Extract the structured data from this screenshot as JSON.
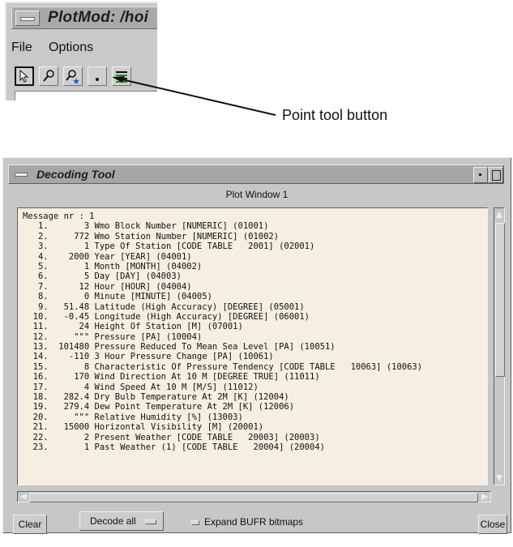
{
  "plotmod": {
    "title": "PlotMod: /hoi",
    "menu": [
      "File",
      "Options"
    ]
  },
  "callout": {
    "label": "Point tool button"
  },
  "decoding_tool": {
    "title": "Decoding Tool",
    "subtitle": "Plot Window 1",
    "lines": [
      "Message nr : 1",
      "   1.       3 Wmo Block Number [NUMERIC] (01001)",
      "   2.     772 Wmo Station Number [NUMERIC] (01002)",
      "   3.       1 Type Of Station [CODE TABLE   2001] (02001)",
      "   4.    2000 Year [YEAR] (04001)",
      "   5.       1 Month [MONTH] (04002)",
      "   6.       5 Day [DAY] (04003)",
      "   7.      12 Hour [HOUR] (04004)",
      "   8.       0 Minute [MINUTE] (04005)",
      "   9.   51.48 Latitude (High Accuracy) [DEGREE] (05001)",
      "  10.   -0.45 Longitude (High Accuracy) [DEGREE] (06001)",
      "  11.      24 Height Of Station [M] (07001)",
      "  12.     \"\"\" Pressure [PA] (10004)",
      "  13.  101480 Pressure Reduced To Mean Sea Level [PA] (10051)",
      "  14.    -110 3 Hour Pressure Change [PA] (10061)",
      "  15.       8 Characteristic Of Pressure Tendency [CODE TABLE   10063] (10063)",
      "  16.     170 Wind Direction At 10 M [DEGREE TRUE] (11011)",
      "  17.       4 Wind Speed At 10 M [M/S] (11012)",
      "  18.   282.4 Dry Bulb Temperature At 2M [K] (12004)",
      "  19.   279.4 Dew Point Temperature At 2M [K] (12006)",
      "  20.     \"\"\" Relative Humidity [%] (13003)",
      "  21.   15000 Horizontal Visibility [M] (20001)",
      "  22.       2 Present Weather [CODE TABLE   20003] (20003)",
      "  23.       1 Past Weather (1) [CODE TABLE   20004] (20004)"
    ],
    "buttons": {
      "clear": "Clear",
      "decode": "Decode all",
      "close": "Close"
    },
    "checkbox_label": "Expand BUFR bitmaps"
  }
}
